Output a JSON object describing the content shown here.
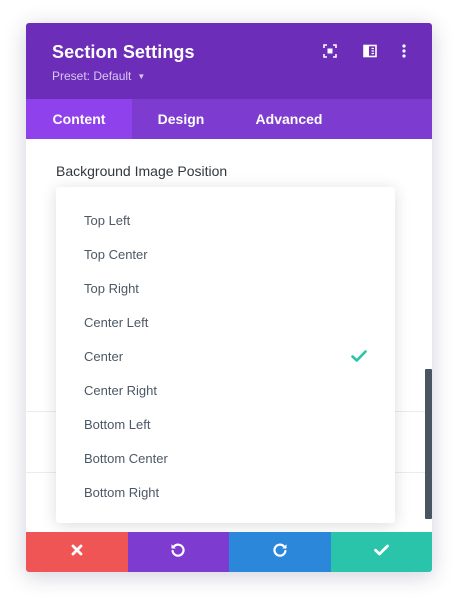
{
  "header": {
    "title": "Section Settings",
    "preset_label": "Preset: Default",
    "background_color": "#6c2eb9",
    "icons": [
      "fullscreen-icon",
      "sidebar-toggle-icon",
      "more-options-icon"
    ]
  },
  "tabs": [
    {
      "label": "Content",
      "active": true
    },
    {
      "label": "Design",
      "active": false
    },
    {
      "label": "Advanced",
      "active": false
    }
  ],
  "field": {
    "label": "Background Image Position",
    "selected": "Center",
    "options": [
      "Top Left",
      "Top Center",
      "Top Right",
      "Center Left",
      "Center",
      "Center Right",
      "Bottom Left",
      "Bottom Center",
      "Bottom Right"
    ],
    "check_color": "#29c4a9"
  },
  "footer": {
    "buttons": [
      {
        "name": "discard-button",
        "icon": "close-icon",
        "color": "#ef5555"
      },
      {
        "name": "undo-button",
        "icon": "undo-icon",
        "color": "#7e3bd0"
      },
      {
        "name": "redo-button",
        "icon": "redo-icon",
        "color": "#2b87da"
      },
      {
        "name": "save-button",
        "icon": "check-icon",
        "color": "#29c4a9"
      }
    ]
  }
}
